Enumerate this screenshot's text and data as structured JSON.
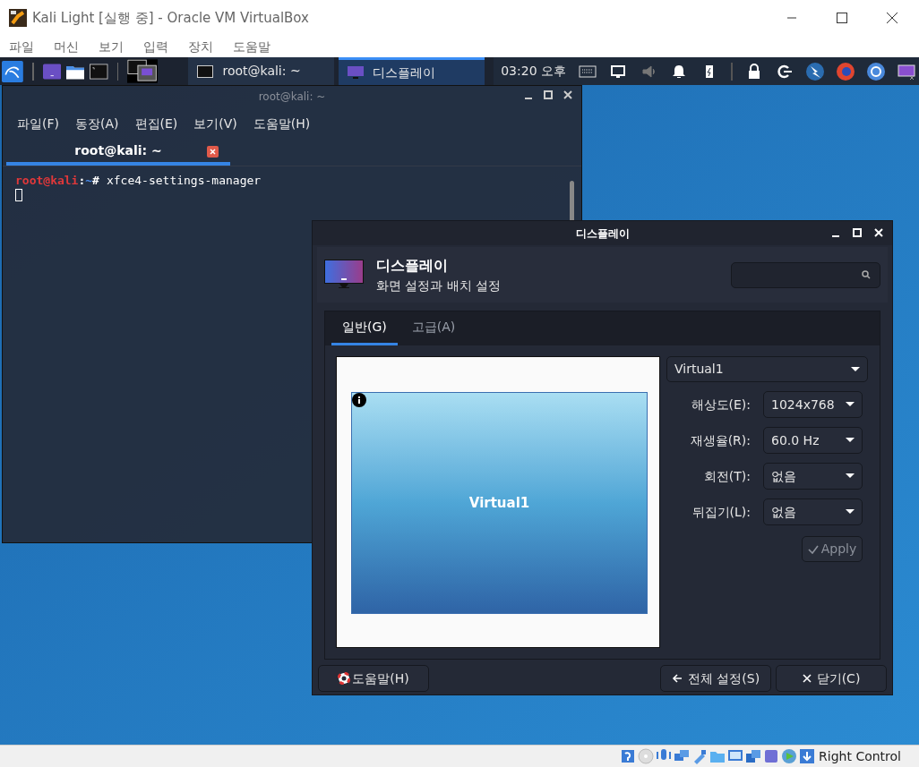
{
  "host_window": {
    "title": "Kali Light [실행 중] - Oracle VM VirtualBox",
    "menu": [
      "파일",
      "머신",
      "보기",
      "입력",
      "장치",
      "도움말"
    ]
  },
  "panel": {
    "tasks": [
      {
        "label": "root@kali: ~",
        "kind": "terminal",
        "selected": false
      },
      {
        "label": "디스플레이",
        "kind": "display",
        "selected": true
      }
    ],
    "clock": "03:20 오후"
  },
  "terminal": {
    "title": "root@kali: ~",
    "menu": [
      "파일(F)",
      "동장(A)",
      "편집(E)",
      "보기(V)",
      "도움말(H)"
    ],
    "tabs": [
      {
        "label": "root@kali: ~",
        "selected": true
      }
    ],
    "prompt": {
      "user": "root@kali",
      "separator": ":",
      "path": "~",
      "symbol": "#"
    },
    "command": "xfce4-settings-manager"
  },
  "display_dialog": {
    "title": "디스플레이",
    "heading": "디스플레이",
    "subtitle": "화면 설정과 배치 설정",
    "tabs": [
      {
        "label": "일반(G)",
        "selected": true
      },
      {
        "label": "고급(A)",
        "selected": false
      }
    ],
    "output": "Virtual1",
    "preview_label": "Virtual1",
    "settings": [
      {
        "label": "해상도(E):",
        "value": "1024x768"
      },
      {
        "label": "재생율(R):",
        "value": "60.0 Hz"
      },
      {
        "label": "회전(T):",
        "value": "없음"
      },
      {
        "label": "뒤집기(L):",
        "value": "없음"
      }
    ],
    "apply": {
      "label": "Apply",
      "disabled": true
    },
    "buttons": [
      {
        "label": "도움말(H)",
        "kind": "help"
      },
      {
        "label": "전체 설정(S)",
        "kind": "back"
      },
      {
        "label": "닫기(C)",
        "kind": "close"
      }
    ]
  },
  "status_bar": {
    "host_key": "Right Control"
  }
}
